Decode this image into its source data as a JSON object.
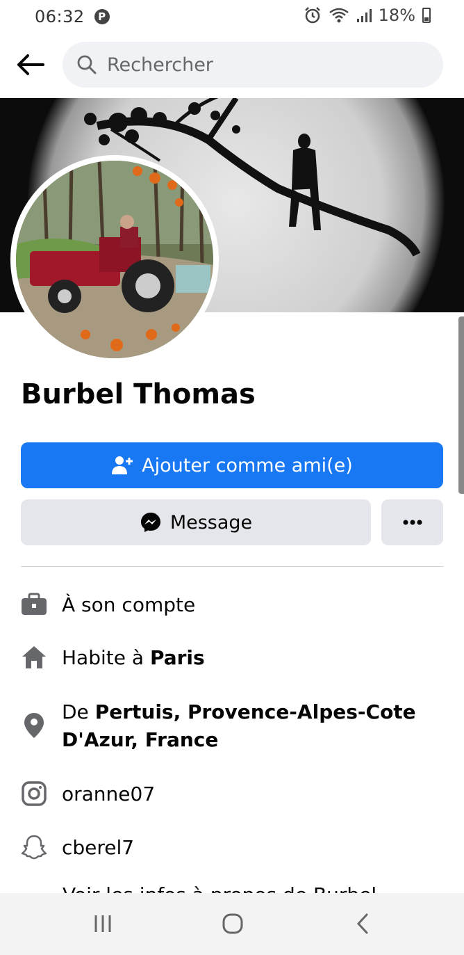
{
  "status_bar": {
    "time": "06:32",
    "notification_icon": "pinterest-icon",
    "battery_percent": "18%"
  },
  "search": {
    "placeholder": "Rechercher"
  },
  "profile": {
    "name": "Burbel Thomas",
    "cover_icon": "moon-silhouette-image",
    "photo_icon": "tractor-photo"
  },
  "actions": {
    "add_friend_label": "Ajouter comme ami(e)",
    "message_label": "Message",
    "more_label": "•••"
  },
  "info": {
    "work": {
      "text": "À son compte",
      "icon": "briefcase-icon"
    },
    "lives": {
      "prefix": "Habite à ",
      "place": "Paris",
      "icon": "home-icon"
    },
    "from": {
      "prefix": "De ",
      "place": "Pertuis, Provence-Alpes-Cote D'Azur, France",
      "icon": "location-pin-icon"
    },
    "instagram": {
      "text": "oranne07",
      "icon": "instagram-icon"
    },
    "snapchat": {
      "text": "cberel7",
      "icon": "snapchat-icon"
    },
    "more_cutoff": "Voir les infos à propos de Burbel"
  },
  "colors": {
    "primary": "#1877f2",
    "secondary_button": "#e4e6eb",
    "search_bg": "#f0f2f5",
    "icon_gray": "#65676b"
  }
}
